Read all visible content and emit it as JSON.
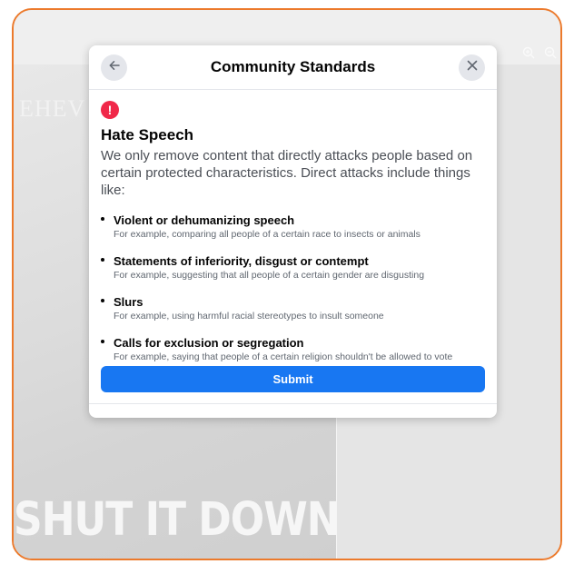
{
  "background": {
    "top_word": "EHEV",
    "bottom_word": "SHUT IT DOWN"
  },
  "modal": {
    "title": "Community Standards",
    "back_icon": "arrow-left-icon",
    "close_icon": "close-icon",
    "alert_icon": "exclamation-icon",
    "alert_symbol": "!",
    "section_title": "Hate Speech",
    "section_description": "We only remove content that directly attacks people based on certain protected characteristics. Direct attacks include things like:",
    "items": [
      {
        "title": "Violent or dehumanizing speech",
        "example": "For example, comparing all people of a certain race to insects or animals"
      },
      {
        "title": "Statements of inferiority, disgust or contempt",
        "example": "For example, suggesting that all people of a certain gender are disgusting"
      },
      {
        "title": "Slurs",
        "example": "For example, using harmful racial stereotypes to insult someone"
      },
      {
        "title": "Calls for exclusion or segregation",
        "example": "For example, saying that people of a certain religion shouldn't be allowed to vote"
      }
    ],
    "submit_label": "Submit"
  },
  "colors": {
    "frame_border": "#ec7a2c",
    "primary_button": "#1877f2",
    "alert": "#f02849",
    "round_button_bg": "#e4e6eb"
  }
}
